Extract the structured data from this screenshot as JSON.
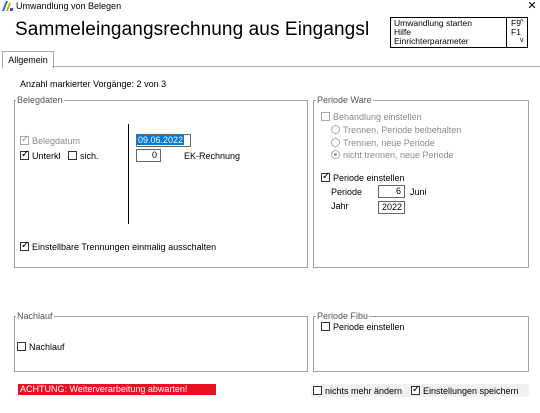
{
  "window": {
    "title": "Umwandlung von Belegen",
    "close_glyph": "✕"
  },
  "heading": "Sammeleingangsrechnung aus Eingangsl",
  "commands": [
    {
      "label": "Umwandlung starten",
      "key": "F9"
    },
    {
      "label": "Hilfe",
      "key": "F1"
    },
    {
      "label": "Einrichterparameter",
      "key": ""
    }
  ],
  "tabs": [
    {
      "label": "Allgemein",
      "active": true
    }
  ],
  "selection_count": "Anzahl markierter Vorgänge: 2 von 3",
  "belegdaten": {
    "title": "Belegdaten",
    "belegdatum": {
      "label": "Belegdatum",
      "checked": true,
      "disabled": true,
      "value": "09.06.2022"
    },
    "unterkl": {
      "label": "Unterkl",
      "checked": true
    },
    "sich": {
      "label": "sich.",
      "checked": false
    },
    "ek_rechnung": {
      "value": "0",
      "label": "EK-Rechnung"
    },
    "trennungen": {
      "label": "Einstellbare Trennungen einmalig ausschalten",
      "checked": true
    }
  },
  "periode_ware": {
    "title": "Periode Ware",
    "behandlung": {
      "label": "Behandlung einstellen",
      "checked": false,
      "disabled": true
    },
    "options": [
      {
        "label": "Trennen, Periode beibehalten",
        "selected": false
      },
      {
        "label": "Trennen, neue Periode",
        "selected": false
      },
      {
        "label": "nicht trennen, neue Periode",
        "selected": true
      }
    ],
    "periode_einstellen": {
      "label": "Periode einstellen",
      "checked": true
    },
    "periode": {
      "label": "Periode",
      "value": "6",
      "month": "Juni"
    },
    "jahr": {
      "label": "Jahr",
      "value": "2022"
    }
  },
  "nachlauf": {
    "title": "Nachlauf",
    "checkbox": {
      "label": "Nachlauf",
      "checked": false
    }
  },
  "periode_fibu": {
    "title": "Periode Fibu",
    "checkbox": {
      "label": "Periode einstellen",
      "checked": false
    }
  },
  "warning": "ACHTUNG: Weiterverarbeitung abwarten!",
  "footer": {
    "nichts_mehr_aendern": {
      "label": "nichts mehr ändern",
      "checked": false
    },
    "einstellungen_speichern": {
      "label": "Einstellungen speichern",
      "checked": true
    }
  },
  "colors": {
    "warning_bg": "#e81123",
    "selection_bg": "#0078d7"
  },
  "check_glyph": "✓"
}
